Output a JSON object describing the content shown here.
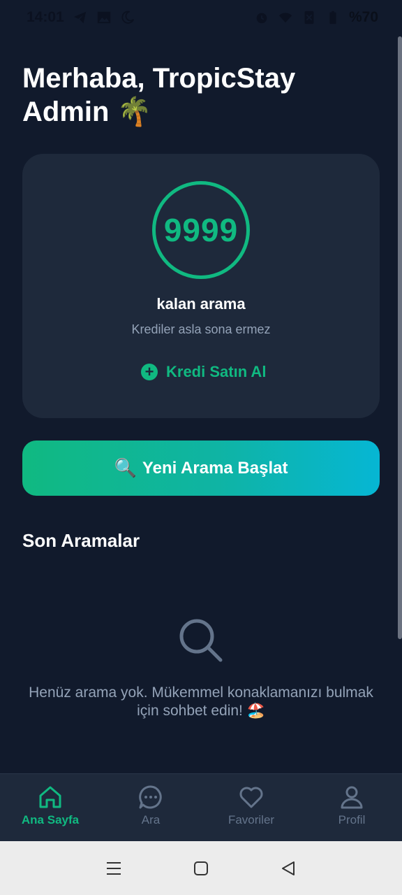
{
  "status_bar": {
    "time": "14:01",
    "battery": "%70"
  },
  "greeting": "Merhaba, TropicStay Admin 🌴",
  "credits": {
    "count": "9999",
    "label": "kalan arama",
    "subtitle": "Krediler asla sona ermez",
    "buy_label": "Kredi Satın Al",
    "accent_color": "#10b981"
  },
  "new_search": {
    "icon": "🔍",
    "label": "Yeni Arama Başlat"
  },
  "recent": {
    "title": "Son Aramalar",
    "empty_message": "Henüz arama yok. Mükemmel konaklamanızı bulmak için sohbet edin! 🏖️"
  },
  "bottom_nav": {
    "items": [
      {
        "label": "Ana Sayfa",
        "icon": "home-icon",
        "active": true
      },
      {
        "label": "Ara",
        "icon": "chat-icon",
        "active": false
      },
      {
        "label": "Favoriler",
        "icon": "heart-icon",
        "active": false
      },
      {
        "label": "Profil",
        "icon": "user-icon",
        "active": false
      }
    ]
  },
  "colors": {
    "background": "#111a2c",
    "card": "#1e293b",
    "muted_text": "#94a3b8",
    "gradient_start": "#10b981",
    "gradient_end": "#06b6d4"
  }
}
